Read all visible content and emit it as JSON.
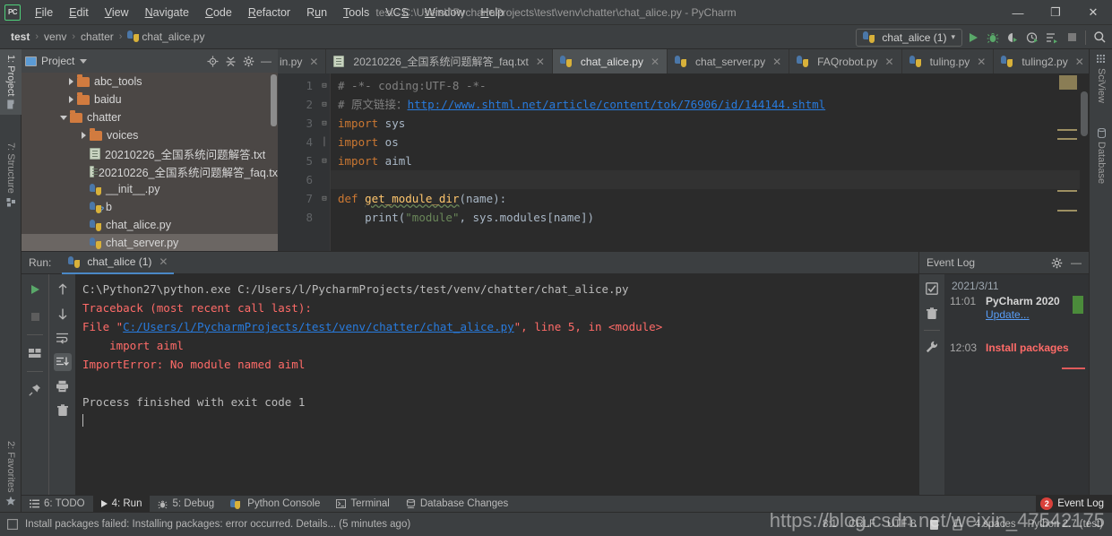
{
  "window": {
    "title": "test - C:\\Users\\l\\PycharmProjects\\test\\venv\\chatter\\chat_alice.py - PyCharm",
    "logo": "PC",
    "minimize": "—",
    "maximize": "❐",
    "close": "✕"
  },
  "menu": [
    "File",
    "Edit",
    "View",
    "Navigate",
    "Code",
    "Refactor",
    "Run",
    "Tools",
    "VCS",
    "Window",
    "Help"
  ],
  "breadcrumb": {
    "items": [
      "test",
      "venv",
      "chatter"
    ],
    "file": "chat_alice.py",
    "separator": "›"
  },
  "toolbar": {
    "run_config": "chat_alice (1)",
    "dropdown_caret": "▾",
    "run_tooltip": "Run",
    "debug_glyph": "🐞",
    "coverage_glyph": "◖",
    "profile_glyph": "◷",
    "flow_glyph": "☰",
    "stop_glyph": "■",
    "search_glyph": "⌕"
  },
  "left_tool_tabs": [
    {
      "label": "1: Project",
      "selected": true
    },
    {
      "label": "7: Structure",
      "selected": false
    },
    {
      "label": "2: Favorites",
      "selected": false
    }
  ],
  "right_tool_tabs": [
    {
      "label": "SciView"
    },
    {
      "label": "Database"
    }
  ],
  "project": {
    "title": "Project",
    "caret": "▾",
    "actions": [
      "target-icon",
      "collapse-icon",
      "gear-icon",
      "minimize-icon"
    ],
    "tree": [
      {
        "label": "abc_tools",
        "type": "folder",
        "arrow": "right",
        "indent": 1,
        "selected": false
      },
      {
        "label": "baidu",
        "type": "folder",
        "arrow": "right",
        "indent": 1,
        "selected": false
      },
      {
        "label": "chatter",
        "type": "folder",
        "arrow": "down",
        "indent": 1,
        "selected": false
      },
      {
        "label": "voices",
        "type": "folder",
        "arrow": "right",
        "indent": 2,
        "selected": false
      },
      {
        "label": "20210226_全国系统问题解答.txt",
        "type": "text",
        "arrow": "none",
        "indent": 2,
        "selected": false
      },
      {
        "label": "20210226_全国系统问题解答_faq.tx",
        "type": "text",
        "arrow": "none",
        "indent": 2,
        "selected": false
      },
      {
        "label": "__init__.py",
        "type": "python",
        "arrow": "none",
        "indent": 2,
        "selected": false
      },
      {
        "label": "b",
        "type": "python-unknown",
        "arrow": "none",
        "indent": 2,
        "selected": false
      },
      {
        "label": "chat_alice.py",
        "type": "python",
        "arrow": "none",
        "indent": 2,
        "selected": false
      },
      {
        "label": "chat_server.py",
        "type": "python",
        "arrow": "none",
        "indent": 2,
        "selected": true
      }
    ]
  },
  "editor": {
    "tabs": [
      {
        "label": "in.py",
        "type": "python",
        "active": false,
        "truncated": true
      },
      {
        "label": "20210226_全国系统问题解答_faq.txt",
        "type": "text",
        "active": false
      },
      {
        "label": "chat_alice.py",
        "type": "python",
        "active": true
      },
      {
        "label": "chat_server.py",
        "type": "python",
        "active": false
      },
      {
        "label": "FAQrobot.py",
        "type": "python",
        "active": false
      },
      {
        "label": "tuling.py",
        "type": "python",
        "active": false
      },
      {
        "label": "tuling2.py",
        "type": "python",
        "active": false
      }
    ],
    "tabs_more": "⌄",
    "tab_close": "✕",
    "line_numbers": [
      "1",
      "2",
      "3",
      "4",
      "5",
      "6",
      "7",
      "8"
    ],
    "code": [
      {
        "fold": "minus",
        "segments": [
          {
            "t": "# -*- coding:UTF-8 -*-",
            "c": "c-comment"
          }
        ]
      },
      {
        "fold": "minus",
        "segments": [
          {
            "t": "# 原文链接：",
            "c": "c-comment"
          },
          {
            "t": "http://www.shtml.net/article/content/tok/76906/id/144144.shtml",
            "c": "c-link"
          }
        ]
      },
      {
        "fold": "minus",
        "segments": [
          {
            "t": "import",
            "c": "c-kw"
          },
          {
            "t": " sys",
            "c": "c-txt"
          }
        ]
      },
      {
        "fold": "bar",
        "segments": [
          {
            "t": "import",
            "c": "c-kw"
          },
          {
            "t": " os",
            "c": "c-txt"
          }
        ]
      },
      {
        "fold": "minus",
        "segments": [
          {
            "t": "import",
            "c": "c-kw"
          },
          {
            "t": " aiml",
            "c": "c-txt"
          }
        ]
      },
      {
        "fold": "none",
        "segments": [
          {
            "t": "",
            "c": "c-txt"
          }
        ]
      },
      {
        "fold": "minus",
        "segments": [
          {
            "t": "def",
            "c": "c-kw"
          },
          {
            "t": " ",
            "c": "c-txt"
          },
          {
            "t": "get_module_dir",
            "c": "c-fn"
          },
          {
            "t": "(name):",
            "c": "c-txt"
          }
        ]
      },
      {
        "fold": "none",
        "segments": [
          {
            "t": "    print(",
            "c": "c-txt"
          },
          {
            "t": "\"module\"",
            "c": "c-str"
          },
          {
            "t": ", sys.modules[name])",
            "c": "c-txt"
          }
        ]
      }
    ]
  },
  "run_panel": {
    "label": "Run:",
    "tab": "chat_alice (1)",
    "tab_close": "✕",
    "head_actions": [
      "gear-icon",
      "minimize-icon"
    ],
    "tools_left": [
      "rerun-icon",
      "stop-icon",
      "layout-icon",
      "pin-icon"
    ],
    "tools_right": [
      "up-arrow-icon",
      "down-arrow-icon",
      "soft-wrap-icon",
      "scroll-to-end-icon",
      "print-icon",
      "trash-icon"
    ],
    "console": [
      {
        "segments": [
          {
            "t": "C:\\Python27\\python.exe C:/Users/l/PycharmProjects/test/venv/chatter/chat_alice.py",
            "c": "cn-normal"
          }
        ]
      },
      {
        "segments": [
          {
            "t": "Traceback (most recent call last):",
            "c": "cn-err"
          }
        ]
      },
      {
        "segments": [
          {
            "t": "  File \"",
            "c": "cn-err"
          },
          {
            "t": "C:/Users/l/PycharmProjects/test/venv/chatter/chat_alice.py",
            "c": "cn-errlink"
          },
          {
            "t": "\", line 5, in <module>",
            "c": "cn-err"
          }
        ]
      },
      {
        "segments": [
          {
            "t": "    import aiml",
            "c": "cn-err"
          }
        ]
      },
      {
        "segments": [
          {
            "t": "ImportError: No module named aiml",
            "c": "cn-err"
          }
        ]
      },
      {
        "segments": [
          {
            "t": "",
            "c": "cn-normal"
          }
        ]
      },
      {
        "segments": [
          {
            "t": "Process finished with exit code 1",
            "c": "cn-normal"
          }
        ]
      }
    ]
  },
  "event_log": {
    "title": "Event Log",
    "actions": [
      "gear-icon",
      "minimize-icon"
    ],
    "tools": [
      "mark-read-icon",
      "trash-icon",
      "settings-wrench-icon"
    ],
    "date": "2021/3/11",
    "entries": [
      {
        "time": "11:01",
        "message": "PyCharm 2020",
        "link": "Update...",
        "error": false
      },
      {
        "time": "12:03",
        "message": "Install packages",
        "link": "",
        "error": true
      }
    ]
  },
  "bottom_tabs": [
    {
      "label": "6: TODO",
      "icon": "list-icon",
      "active": false
    },
    {
      "label": "4: Run",
      "icon": "play-icon",
      "active": true
    },
    {
      "label": "5: Debug",
      "icon": "bug-icon",
      "active": false
    },
    {
      "label": "Python Console",
      "icon": "python-icon",
      "active": false
    },
    {
      "label": "Terminal",
      "icon": "terminal-icon",
      "active": false
    },
    {
      "label": "Database Changes",
      "icon": "database-icon",
      "active": false
    }
  ],
  "event_pill": {
    "count": "2",
    "label": "Event Log"
  },
  "status_bar": {
    "message": "Install packages failed: Installing packages: error occurred. Details... (5 minutes ago)",
    "caret_position": "8:1",
    "line_separator": "CRLF",
    "encoding": "UTF-8",
    "indent": "4 spaces",
    "interpreter": "Python 2.7 (test)",
    "lock_icon": "lock-icon",
    "inspect_icon": "inspection-icon"
  },
  "watermark": "https://blog.csdn.net/weixin_47542175",
  "colors": {
    "accent_green": "#59a869",
    "error_red": "#ff6b68",
    "link_blue": "#287bde",
    "tab_underline": "#4a88c7",
    "panel_bg": "#3c3f41",
    "editor_bg": "#2b2b2b",
    "tree_bg": "#4b4745"
  }
}
